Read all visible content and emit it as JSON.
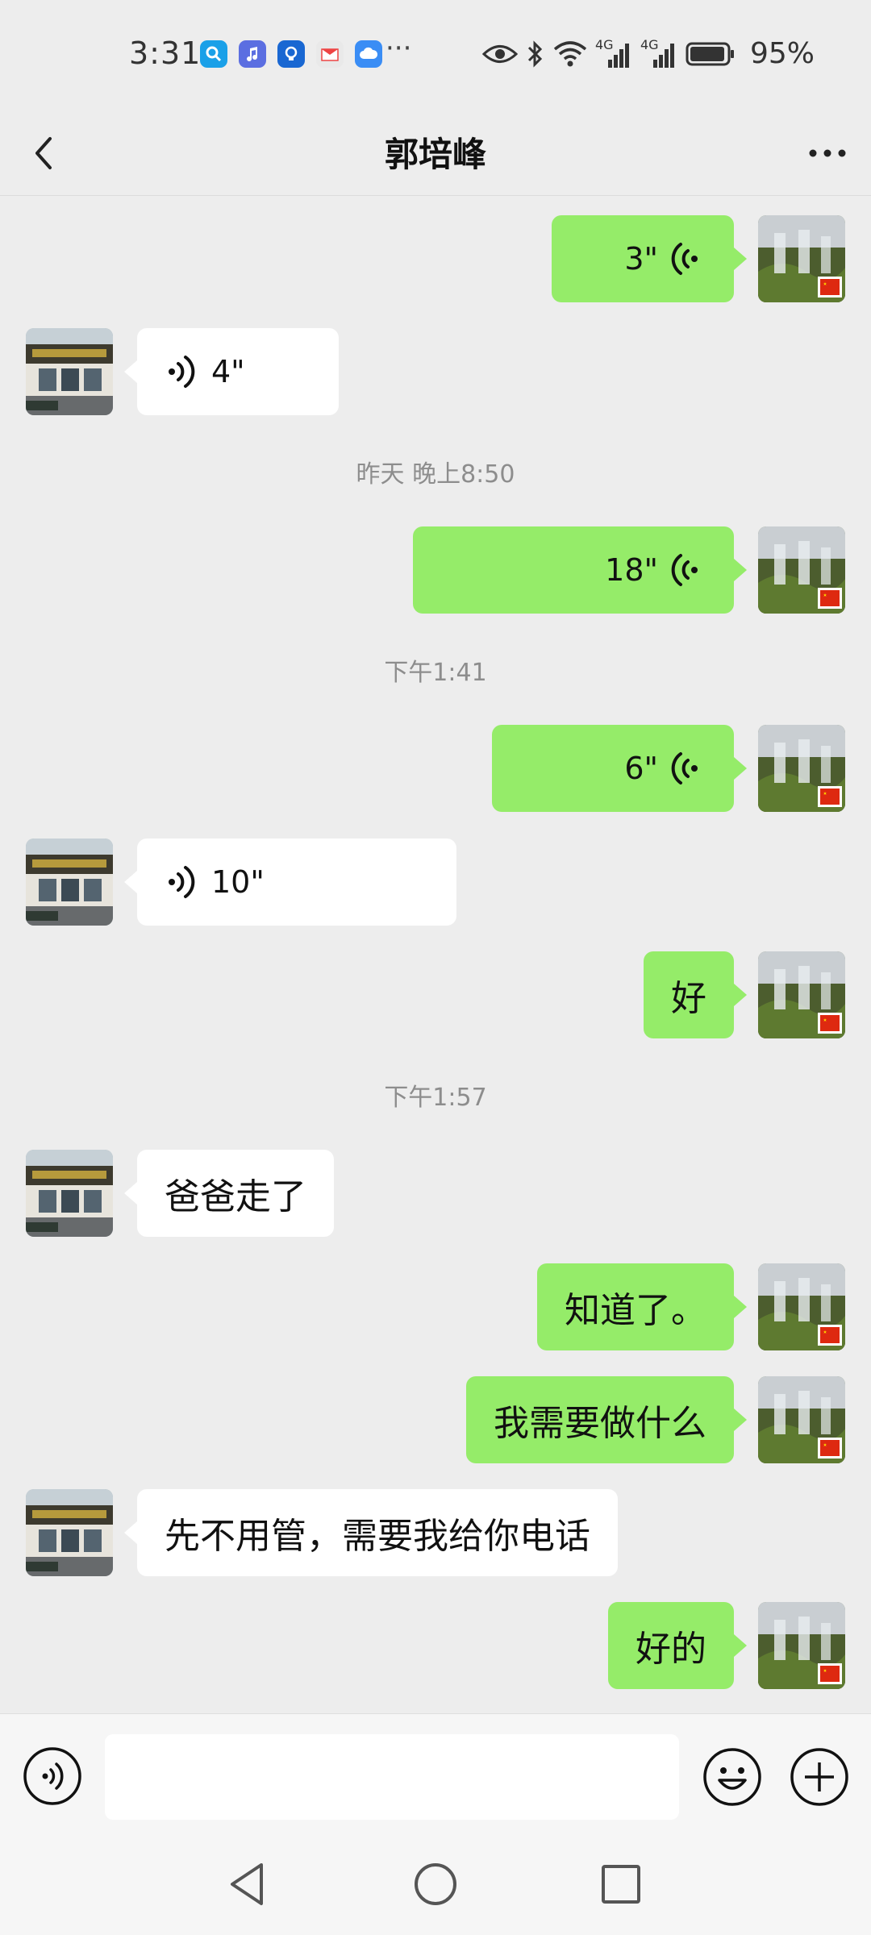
{
  "status_bar": {
    "time": "3:31",
    "app_icons": [
      "search-app-icon",
      "music-app-icon",
      "bulb-app-icon",
      "mail-app-icon",
      "cloud-app-icon"
    ],
    "more_indicator": "···",
    "network_1": "4G",
    "network_2": "4G",
    "battery_percent": "95%",
    "battery_level": 0.95
  },
  "header": {
    "title": "郭培峰",
    "back_icon": "chevron-left-icon",
    "more_icon": "more-horizontal-icon"
  },
  "messages": [
    {
      "type": "voice",
      "direction": "out",
      "duration": "3\""
    },
    {
      "type": "voice",
      "direction": "in",
      "duration": "4\""
    },
    {
      "type": "timestamp",
      "text": "昨天 晚上8:50"
    },
    {
      "type": "voice",
      "direction": "out",
      "duration": "18\""
    },
    {
      "type": "timestamp",
      "text": "下午1:41"
    },
    {
      "type": "voice",
      "direction": "out",
      "duration": "6\""
    },
    {
      "type": "voice",
      "direction": "in",
      "duration": "10\""
    },
    {
      "type": "text",
      "direction": "out",
      "text": "好"
    },
    {
      "type": "timestamp",
      "text": "下午1:57"
    },
    {
      "type": "text",
      "direction": "in",
      "text": "爸爸走了"
    },
    {
      "type": "text",
      "direction": "out",
      "text": "知道了。"
    },
    {
      "type": "text",
      "direction": "out",
      "text": "我需要做什么"
    },
    {
      "type": "text",
      "direction": "in",
      "text": "先不用管，需要我给你电话"
    },
    {
      "type": "text",
      "direction": "out",
      "text": "好的"
    }
  ],
  "input_bar": {
    "value": "",
    "voice_icon": "voice-input-icon",
    "emoji_icon": "emoji-icon",
    "plus_icon": "plus-circle-icon"
  },
  "system_nav": {
    "back_icon": "triangle-back-icon",
    "home_icon": "circle-home-icon",
    "recents_icon": "square-recents-icon"
  },
  "colors": {
    "background": "#ededed",
    "outgoing_bubble": "#95ec69",
    "incoming_bubble": "#ffffff",
    "timestamp_text": "#8d8d8d"
  }
}
